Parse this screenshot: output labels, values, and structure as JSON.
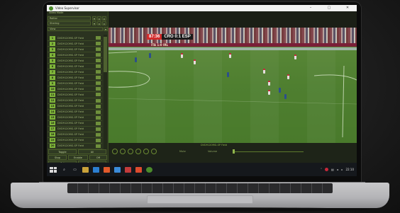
{
  "window": {
    "title": "Video Supervisor",
    "minimize": "–",
    "maximize": "▢",
    "close": "✕"
  },
  "panel": {
    "header": "Video Mode",
    "combo_a": "Rolllar",
    "combo_b": "Shering",
    "section": "View",
    "channels": [
      {
        "num": "1",
        "name": "DVD9120MG-SP Field"
      },
      {
        "num": "2",
        "name": "DVD9120MG-SP Field"
      },
      {
        "num": "3",
        "name": "DVD9120MG-SP Field"
      },
      {
        "num": "4",
        "name": "DVD9120MG-SP Field"
      },
      {
        "num": "5",
        "name": "DVD9120MG-SP Field"
      },
      {
        "num": "6",
        "name": "DVD9120MG-SP Field"
      },
      {
        "num": "7",
        "name": "DVD9120MG-SP Field"
      },
      {
        "num": "8",
        "name": "DVD9120MG-SP Field"
      },
      {
        "num": "9",
        "name": "DVD9120MG-SP Field"
      },
      {
        "num": "10",
        "name": "DVD9120MG-SP Field"
      },
      {
        "num": "11",
        "name": "DVD9120MG-SP Field"
      },
      {
        "num": "12",
        "name": "DVD9120MG-SP Field"
      },
      {
        "num": "13",
        "name": "DVD9120MG-SP Field"
      },
      {
        "num": "14",
        "name": "DVD9120MG-SP Field"
      },
      {
        "num": "15",
        "name": "DVD9120MG-SP Field"
      },
      {
        "num": "16",
        "name": "DVD9120MG-SP Field"
      },
      {
        "num": "17",
        "name": "DVD9120MG-SP Field"
      },
      {
        "num": "18",
        "name": "DVD9120MG-SP Field"
      },
      {
        "num": "19",
        "name": "DVD9120MG-SP Field"
      },
      {
        "num": "20",
        "name": "DVD9120MG-SP Field"
      }
    ],
    "btn_toggle": "Toggle",
    "btn_all": "All",
    "btn_stop": "Stop",
    "btn_enable": "Enable",
    "btn_off": "Off",
    "btn_set": "Set",
    "btn_enable2": "Enlarge"
  },
  "video": {
    "time": "87:36",
    "score": "CRO 0:1 ESP",
    "board_text": "ITA 1:0 IRL"
  },
  "controls": {
    "title": "DVD9120MG-SP Field",
    "label_left": "Mute",
    "label_right": "Volume"
  },
  "taskbar": {
    "time": "22:10"
  },
  "colors": {
    "accent": "#7fb53a",
    "panel": "#2b3320",
    "taskbar": "#15181c"
  }
}
